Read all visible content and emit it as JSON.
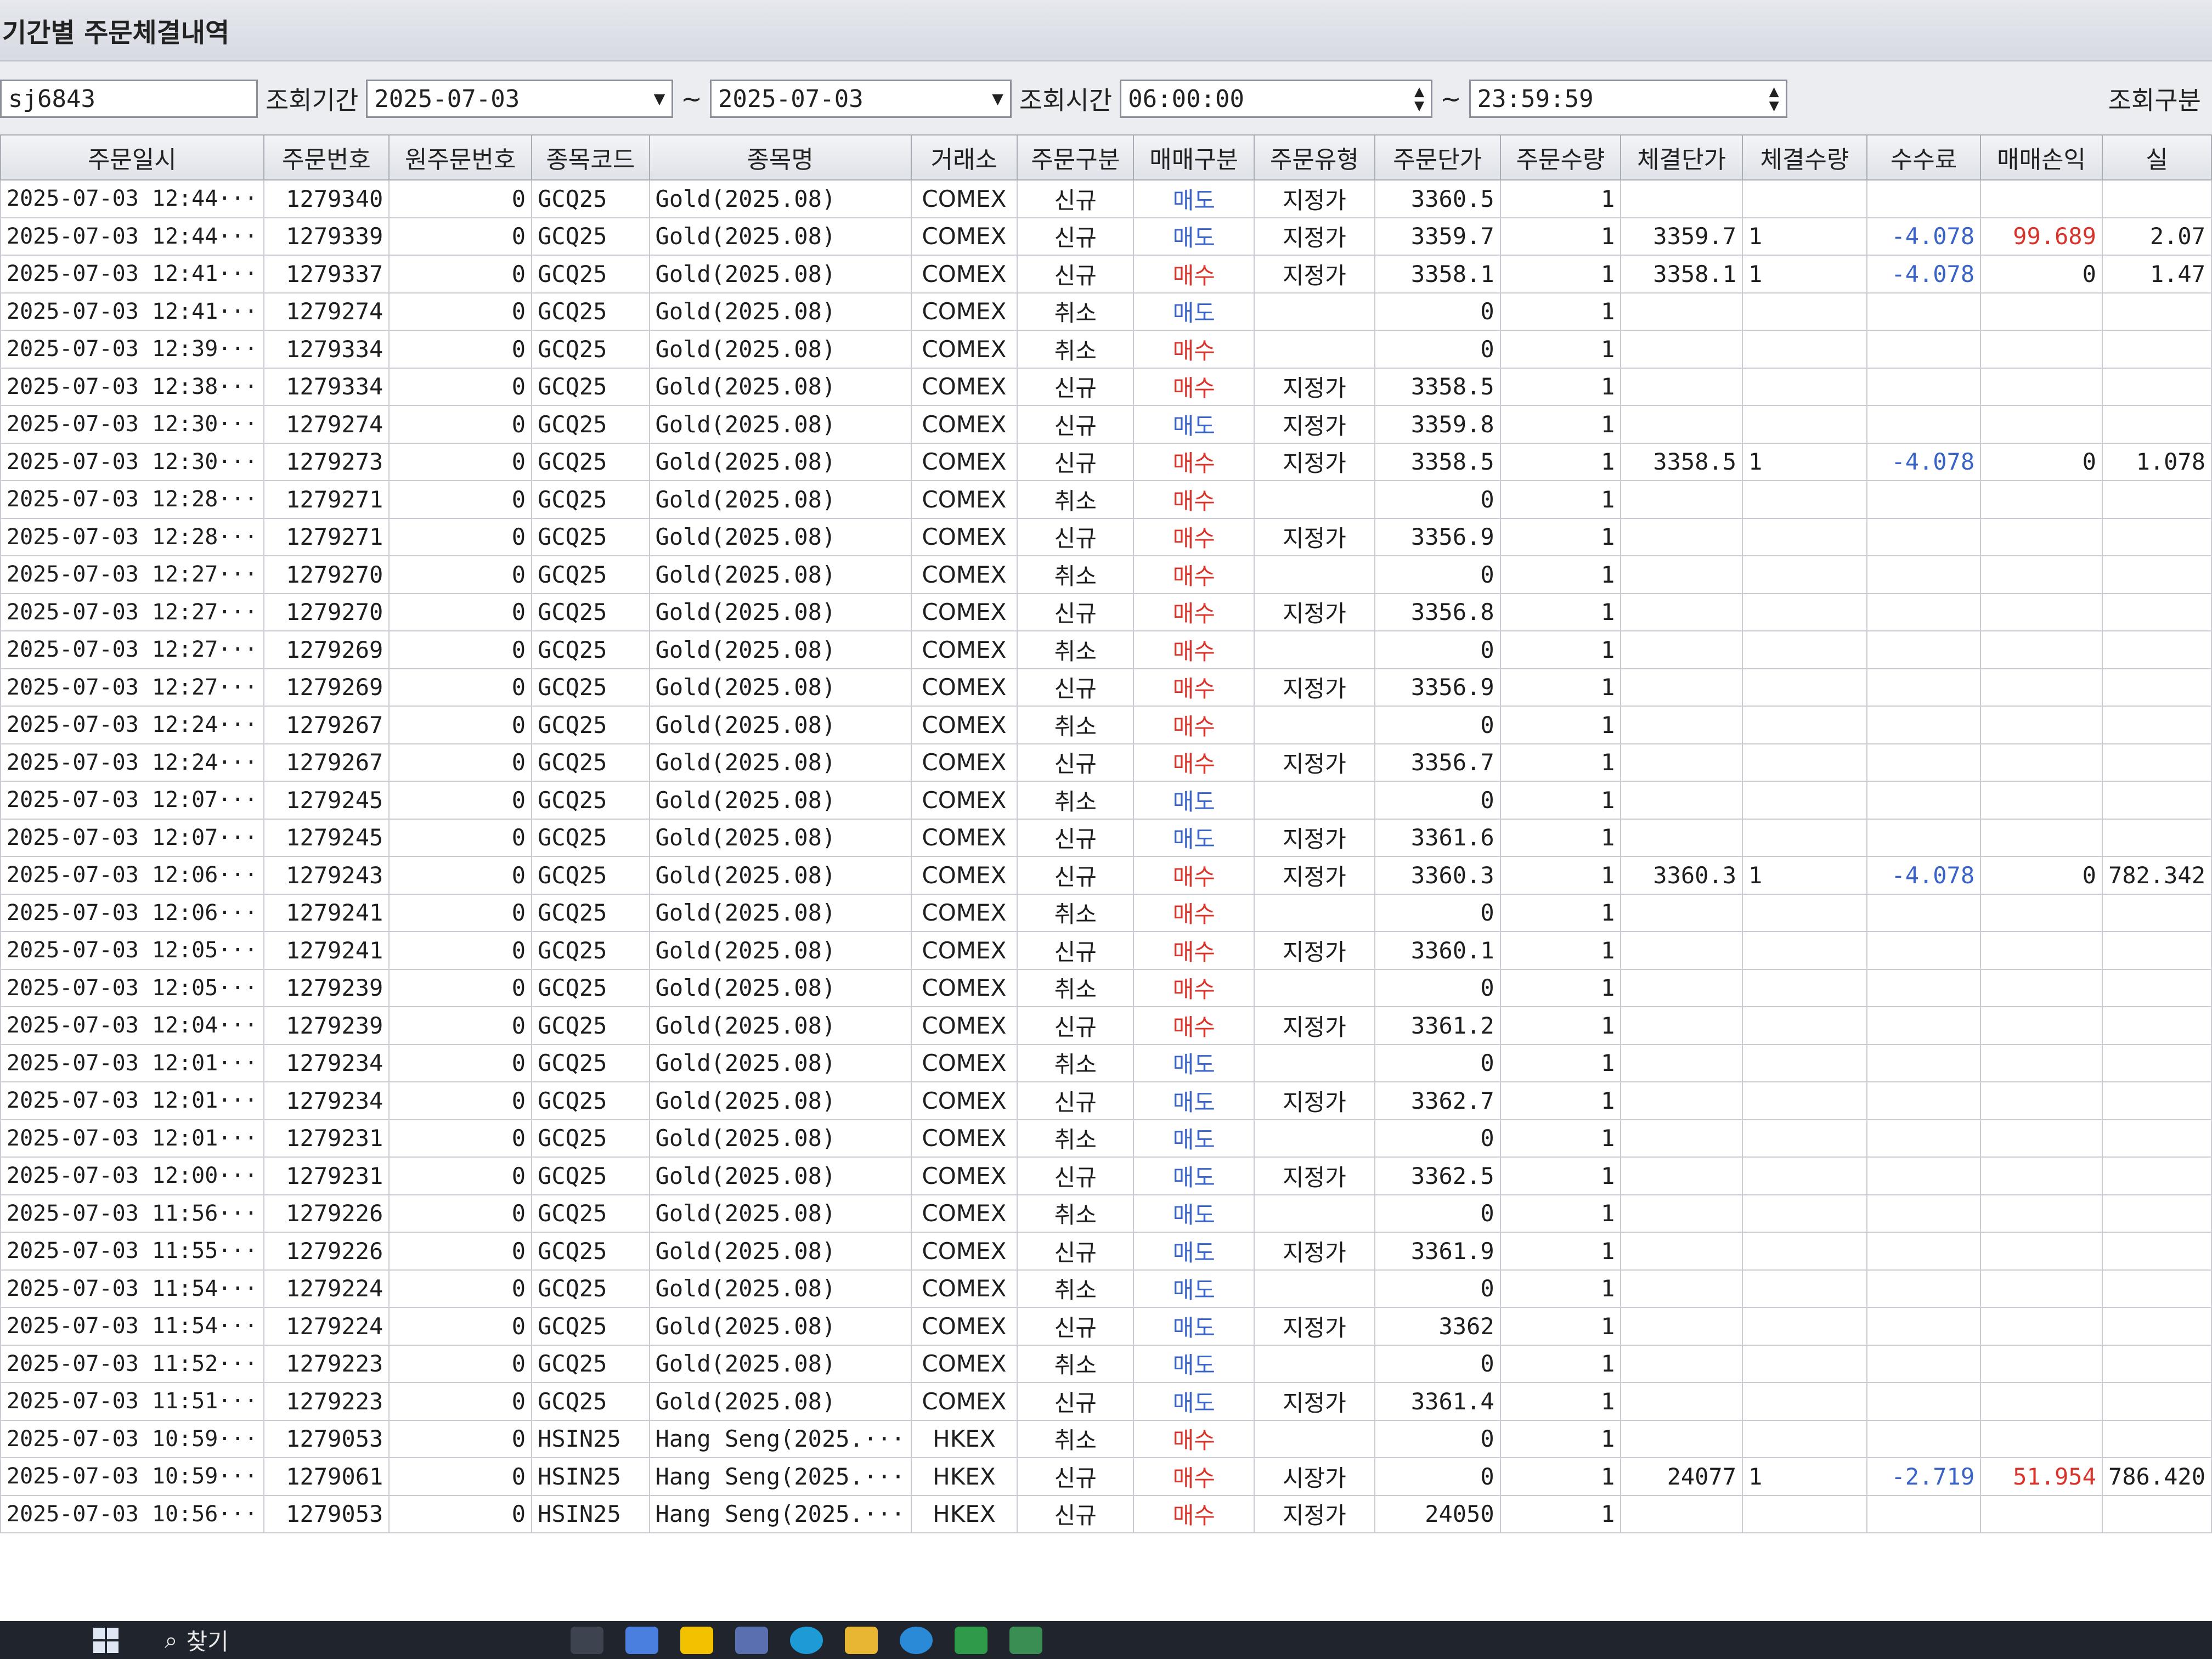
{
  "window": {
    "title": "기간별 주문체결내역"
  },
  "filter": {
    "account": "sj6843",
    "period_label": "조회기간",
    "date_from": "2025-07-03",
    "tilde": "~",
    "date_to": "2025-07-03",
    "time_label": "조회시간",
    "time_from": "06:00:00",
    "time_to": "23:59:59",
    "type_label": "조회구분"
  },
  "columns": [
    "주문일시",
    "주문번호",
    "원주문번호",
    "종목코드",
    "종목명",
    "거래소",
    "주문구분",
    "매매구분",
    "주문유형",
    "주문단가",
    "주문수량",
    "체결단가",
    "체결수량",
    "수수료",
    "매매손익",
    "실"
  ],
  "rows": [
    [
      "2025-07-03 12:44···",
      "1279340",
      "0",
      "GCQ25",
      "Gold(2025.08)",
      "COMEX",
      "신규",
      "매도",
      "지정가",
      "3360.5",
      "1",
      "",
      "",
      "",
      "",
      ""
    ],
    [
      "2025-07-03 12:44···",
      "1279339",
      "0",
      "GCQ25",
      "Gold(2025.08)",
      "COMEX",
      "신규",
      "매도",
      "지정가",
      "3359.7",
      "1",
      "3359.7",
      "1",
      "-4.078",
      "99.689",
      "2.07"
    ],
    [
      "2025-07-03 12:41···",
      "1279337",
      "0",
      "GCQ25",
      "Gold(2025.08)",
      "COMEX",
      "신규",
      "매수",
      "지정가",
      "3358.1",
      "1",
      "3358.1",
      "1",
      "-4.078",
      "0",
      "1.47"
    ],
    [
      "2025-07-03 12:41···",
      "1279274",
      "0",
      "GCQ25",
      "Gold(2025.08)",
      "COMEX",
      "취소",
      "매도",
      "",
      "0",
      "1",
      "",
      "",
      "",
      "",
      ""
    ],
    [
      "2025-07-03 12:39···",
      "1279334",
      "0",
      "GCQ25",
      "Gold(2025.08)",
      "COMEX",
      "취소",
      "매수",
      "",
      "0",
      "1",
      "",
      "",
      "",
      "",
      ""
    ],
    [
      "2025-07-03 12:38···",
      "1279334",
      "0",
      "GCQ25",
      "Gold(2025.08)",
      "COMEX",
      "신규",
      "매수",
      "지정가",
      "3358.5",
      "1",
      "",
      "",
      "",
      "",
      ""
    ],
    [
      "2025-07-03 12:30···",
      "1279274",
      "0",
      "GCQ25",
      "Gold(2025.08)",
      "COMEX",
      "신규",
      "매도",
      "지정가",
      "3359.8",
      "1",
      "",
      "",
      "",
      "",
      ""
    ],
    [
      "2025-07-03 12:30···",
      "1279273",
      "0",
      "GCQ25",
      "Gold(2025.08)",
      "COMEX",
      "신규",
      "매수",
      "지정가",
      "3358.5",
      "1",
      "3358.5",
      "1",
      "-4.078",
      "0",
      "1.078"
    ],
    [
      "2025-07-03 12:28···",
      "1279271",
      "0",
      "GCQ25",
      "Gold(2025.08)",
      "COMEX",
      "취소",
      "매수",
      "",
      "0",
      "1",
      "",
      "",
      "",
      "",
      ""
    ],
    [
      "2025-07-03 12:28···",
      "1279271",
      "0",
      "GCQ25",
      "Gold(2025.08)",
      "COMEX",
      "신규",
      "매수",
      "지정가",
      "3356.9",
      "1",
      "",
      "",
      "",
      "",
      ""
    ],
    [
      "2025-07-03 12:27···",
      "1279270",
      "0",
      "GCQ25",
      "Gold(2025.08)",
      "COMEX",
      "취소",
      "매수",
      "",
      "0",
      "1",
      "",
      "",
      "",
      "",
      ""
    ],
    [
      "2025-07-03 12:27···",
      "1279270",
      "0",
      "GCQ25",
      "Gold(2025.08)",
      "COMEX",
      "신규",
      "매수",
      "지정가",
      "3356.8",
      "1",
      "",
      "",
      "",
      "",
      ""
    ],
    [
      "2025-07-03 12:27···",
      "1279269",
      "0",
      "GCQ25",
      "Gold(2025.08)",
      "COMEX",
      "취소",
      "매수",
      "",
      "0",
      "1",
      "",
      "",
      "",
      "",
      ""
    ],
    [
      "2025-07-03 12:27···",
      "1279269",
      "0",
      "GCQ25",
      "Gold(2025.08)",
      "COMEX",
      "신규",
      "매수",
      "지정가",
      "3356.9",
      "1",
      "",
      "",
      "",
      "",
      ""
    ],
    [
      "2025-07-03 12:24···",
      "1279267",
      "0",
      "GCQ25",
      "Gold(2025.08)",
      "COMEX",
      "취소",
      "매수",
      "",
      "0",
      "1",
      "",
      "",
      "",
      "",
      ""
    ],
    [
      "2025-07-03 12:24···",
      "1279267",
      "0",
      "GCQ25",
      "Gold(2025.08)",
      "COMEX",
      "신규",
      "매수",
      "지정가",
      "3356.7",
      "1",
      "",
      "",
      "",
      "",
      ""
    ],
    [
      "2025-07-03 12:07···",
      "1279245",
      "0",
      "GCQ25",
      "Gold(2025.08)",
      "COMEX",
      "취소",
      "매도",
      "",
      "0",
      "1",
      "",
      "",
      "",
      "",
      ""
    ],
    [
      "2025-07-03 12:07···",
      "1279245",
      "0",
      "GCQ25",
      "Gold(2025.08)",
      "COMEX",
      "신규",
      "매도",
      "지정가",
      "3361.6",
      "1",
      "",
      "",
      "",
      "",
      ""
    ],
    [
      "2025-07-03 12:06···",
      "1279243",
      "0",
      "GCQ25",
      "Gold(2025.08)",
      "COMEX",
      "신규",
      "매수",
      "지정가",
      "3360.3",
      "1",
      "3360.3",
      "1",
      "-4.078",
      "0",
      "782.342"
    ],
    [
      "2025-07-03 12:06···",
      "1279241",
      "0",
      "GCQ25",
      "Gold(2025.08)",
      "COMEX",
      "취소",
      "매수",
      "",
      "0",
      "1",
      "",
      "",
      "",
      "",
      ""
    ],
    [
      "2025-07-03 12:05···",
      "1279241",
      "0",
      "GCQ25",
      "Gold(2025.08)",
      "COMEX",
      "신규",
      "매수",
      "지정가",
      "3360.1",
      "1",
      "",
      "",
      "",
      "",
      ""
    ],
    [
      "2025-07-03 12:05···",
      "1279239",
      "0",
      "GCQ25",
      "Gold(2025.08)",
      "COMEX",
      "취소",
      "매수",
      "",
      "0",
      "1",
      "",
      "",
      "",
      "",
      ""
    ],
    [
      "2025-07-03 12:04···",
      "1279239",
      "0",
      "GCQ25",
      "Gold(2025.08)",
      "COMEX",
      "신규",
      "매수",
      "지정가",
      "3361.2",
      "1",
      "",
      "",
      "",
      "",
      ""
    ],
    [
      "2025-07-03 12:01···",
      "1279234",
      "0",
      "GCQ25",
      "Gold(2025.08)",
      "COMEX",
      "취소",
      "매도",
      "",
      "0",
      "1",
      "",
      "",
      "",
      "",
      ""
    ],
    [
      "2025-07-03 12:01···",
      "1279234",
      "0",
      "GCQ25",
      "Gold(2025.08)",
      "COMEX",
      "신규",
      "매도",
      "지정가",
      "3362.7",
      "1",
      "",
      "",
      "",
      "",
      ""
    ],
    [
      "2025-07-03 12:01···",
      "1279231",
      "0",
      "GCQ25",
      "Gold(2025.08)",
      "COMEX",
      "취소",
      "매도",
      "",
      "0",
      "1",
      "",
      "",
      "",
      "",
      ""
    ],
    [
      "2025-07-03 12:00···",
      "1279231",
      "0",
      "GCQ25",
      "Gold(2025.08)",
      "COMEX",
      "신규",
      "매도",
      "지정가",
      "3362.5",
      "1",
      "",
      "",
      "",
      "",
      ""
    ],
    [
      "2025-07-03 11:56···",
      "1279226",
      "0",
      "GCQ25",
      "Gold(2025.08)",
      "COMEX",
      "취소",
      "매도",
      "",
      "0",
      "1",
      "",
      "",
      "",
      "",
      ""
    ],
    [
      "2025-07-03 11:55···",
      "1279226",
      "0",
      "GCQ25",
      "Gold(2025.08)",
      "COMEX",
      "신규",
      "매도",
      "지정가",
      "3361.9",
      "1",
      "",
      "",
      "",
      "",
      ""
    ],
    [
      "2025-07-03 11:54···",
      "1279224",
      "0",
      "GCQ25",
      "Gold(2025.08)",
      "COMEX",
      "취소",
      "매도",
      "",
      "0",
      "1",
      "",
      "",
      "",
      "",
      ""
    ],
    [
      "2025-07-03 11:54···",
      "1279224",
      "0",
      "GCQ25",
      "Gold(2025.08)",
      "COMEX",
      "신규",
      "매도",
      "지정가",
      "3362",
      "1",
      "",
      "",
      "",
      "",
      ""
    ],
    [
      "2025-07-03 11:52···",
      "1279223",
      "0",
      "GCQ25",
      "Gold(2025.08)",
      "COMEX",
      "취소",
      "매도",
      "",
      "0",
      "1",
      "",
      "",
      "",
      "",
      ""
    ],
    [
      "2025-07-03 11:51···",
      "1279223",
      "0",
      "GCQ25",
      "Gold(2025.08)",
      "COMEX",
      "신규",
      "매도",
      "지정가",
      "3361.4",
      "1",
      "",
      "",
      "",
      "",
      ""
    ],
    [
      "2025-07-03 10:59···",
      "1279053",
      "0",
      "HSIN25",
      "Hang Seng(2025.···",
      "HKEX",
      "취소",
      "매수",
      "",
      "0",
      "1",
      "",
      "",
      "",
      "",
      ""
    ],
    [
      "2025-07-03 10:59···",
      "1279061",
      "0",
      "HSIN25",
      "Hang Seng(2025.···",
      "HKEX",
      "신규",
      "매수",
      "시장가",
      "0",
      "1",
      "24077",
      "1",
      "-2.719",
      "51.954",
      "786.420"
    ],
    [
      "2025-07-03 10:56···",
      "1279053",
      "0",
      "HSIN25",
      "Hang Seng(2025.···",
      "HKEX",
      "신규",
      "매수",
      "지정가",
      "24050",
      "1",
      "",
      "",
      "",
      "",
      ""
    ]
  ],
  "taskbar": {
    "search_label": "찾기"
  },
  "colors": {
    "sell": "#3a63c8",
    "buy": "#d9342b"
  }
}
